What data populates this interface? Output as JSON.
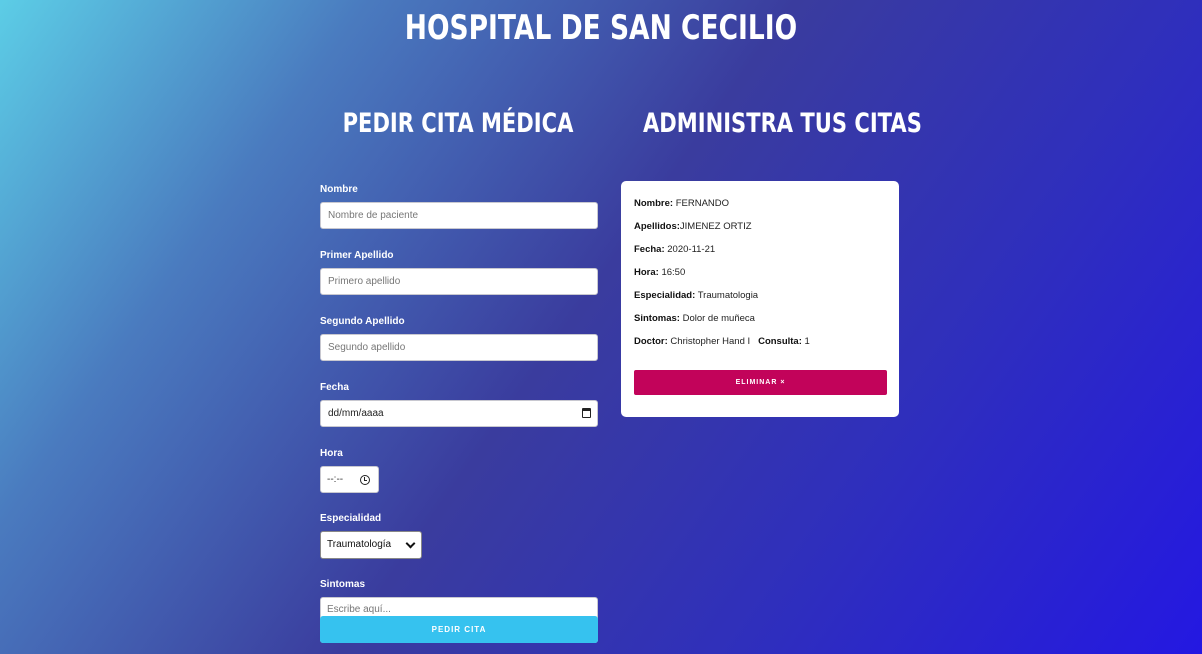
{
  "header": {
    "title": "HOSPITAL DE SAN CECILIO"
  },
  "form": {
    "title": "PEDIR CITA MÉDICA",
    "nombre": {
      "label": "Nombre",
      "placeholder": "Nombre de paciente"
    },
    "primer_apellido": {
      "label": "Primer Apellido",
      "placeholder": "Primero apellido"
    },
    "segundo_apellido": {
      "label": "Segundo Apellido",
      "placeholder": "Segundo apellido"
    },
    "fecha": {
      "label": "Fecha",
      "value": "dd/mm/aaaa"
    },
    "hora": {
      "label": "Hora",
      "value": "--:--"
    },
    "especialidad": {
      "label": "Especialidad",
      "selected": "Traumatología"
    },
    "sintomas": {
      "label": "Sintomas",
      "placeholder": "Escribe aquí..."
    },
    "submit_label": "PEDIR CITA"
  },
  "appointments": {
    "title": "ADMINISTRA TUS CITAS",
    "items": [
      {
        "nombre_label": "Nombre:",
        "nombre": "FERNANDO",
        "apellidos_label": "Apellidos:",
        "apellidos": "JIMENEZ ORTIZ",
        "fecha_label": "Fecha:",
        "fecha": "2020-11-21",
        "hora_label": "Hora:",
        "hora": "16:50",
        "especialidad_label": "Especialidad:",
        "especialidad": "Traumatologia",
        "sintomas_label": "Sintomas:",
        "sintomas": "Dolor de muñeca",
        "doctor_label": "Doctor:",
        "doctor": "Christopher Hand I",
        "consulta_label": "Consulta:",
        "consulta": "1",
        "delete_label": "ELIMINAR ×"
      }
    ]
  },
  "colors": {
    "submit_button": "#36c2ef",
    "delete_button": "#c2035a",
    "gradient_start": "#5ccde6",
    "gradient_end": "#2418e2"
  }
}
